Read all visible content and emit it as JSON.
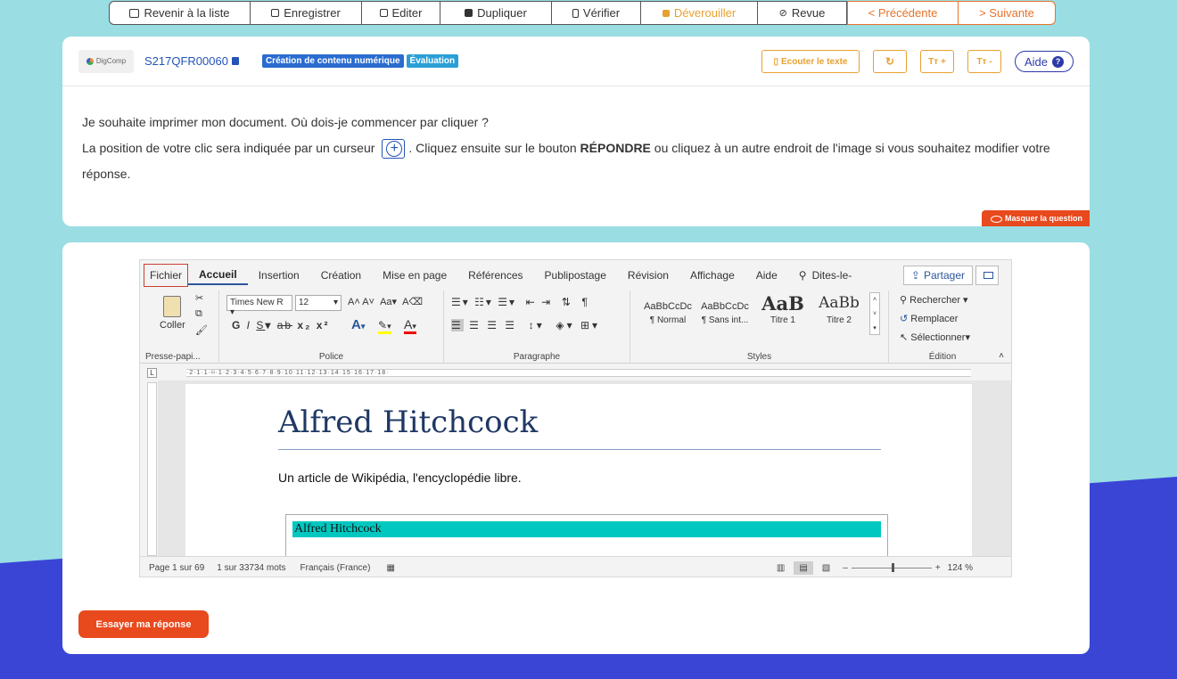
{
  "topbar": {
    "back": "Revenir à la liste",
    "save": "Enregistrer",
    "edit": "Editer",
    "duplicate": "Dupliquer",
    "verify": "Vérifier",
    "unlock": "Déverouiller",
    "review": "Revue",
    "prev": "< Précédente",
    "next": "> Suivante"
  },
  "question": {
    "logo": "DigComp",
    "id": "S217QFR00060",
    "tags": [
      "Création de contenu numérique",
      "Évaluation"
    ],
    "listen": "Ecouter le texte",
    "font_plus": "Tт +",
    "font_minus": "Tт -",
    "help": "Aide",
    "line1": "Je souhaite imprimer mon document. Où dois-je commencer par cliquer ?",
    "line2a": "La position de votre clic sera indiquée par un curseur",
    "line2b": ". Cliquez ensuite sur le bouton ",
    "line2bold": "RÉPONDRE",
    "line2c": " ou cliquez à un autre endroit de l'image si vous souhaitez modifier votre réponse.",
    "hide": "Masquer la question",
    "submit": "Essayer ma réponse"
  },
  "word": {
    "menu": [
      "Fichier",
      "Accueil",
      "Insertion",
      "Création",
      "Mise en page",
      "Références",
      "Publipostage",
      "Révision",
      "Affichage",
      "Aide",
      "Dites-le-"
    ],
    "share": "Partager",
    "groups": {
      "clipboard": "Presse-papi...",
      "paste": "Coller",
      "font": "Police",
      "font_name": "Times New R",
      "font_size": "12",
      "paragraph": "Paragraphe",
      "styles": "Styles",
      "editing": "Édition"
    },
    "styles": [
      {
        "preview": "AaBbCcDc",
        "name": "¶ Normal"
      },
      {
        "preview": "AaBbCcDc",
        "name": "¶ Sans int..."
      },
      {
        "preview": "AaB",
        "name": "Titre 1"
      },
      {
        "preview": "AaBb",
        "name": "Titre 2"
      }
    ],
    "editing_items": [
      "Rechercher",
      "Remplacer",
      "Sélectionner"
    ],
    "doc_title": "Alfred Hitchcock",
    "doc_sub": "Un article de Wikipédia, l'encyclopédie libre.",
    "box_title": "Alfred Hitchcock",
    "status": {
      "page": "Page 1 sur 69",
      "words": "1 sur 33734 mots",
      "lang": "Français (France)",
      "zoom": "124 %"
    }
  }
}
